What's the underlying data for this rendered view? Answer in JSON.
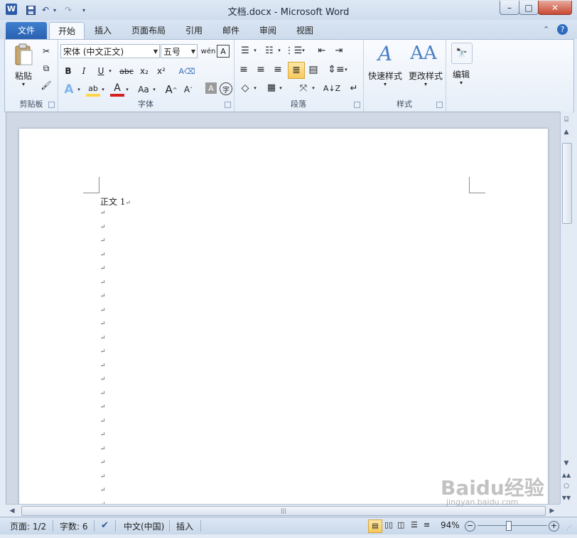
{
  "window": {
    "title": "文档.docx - Microsoft Word",
    "app_icon": "W",
    "controls": {
      "minimize": "–",
      "maximize": "□",
      "close": "✕"
    }
  },
  "quick_access": {
    "save_icon": "save-icon",
    "undo_icon": "undo-icon",
    "redo_icon": "redo-icon"
  },
  "tabs": [
    {
      "label": "文件"
    },
    {
      "label": "开始"
    },
    {
      "label": "插入"
    },
    {
      "label": "页面布局"
    },
    {
      "label": "引用"
    },
    {
      "label": "邮件"
    },
    {
      "label": "审阅"
    },
    {
      "label": "视图"
    }
  ],
  "ribbon": {
    "clipboard": {
      "label": "剪贴板",
      "paste": "粘贴"
    },
    "font": {
      "label": "字体",
      "font_name": "宋体 (中文正文)",
      "font_size": "五号",
      "bold": "B",
      "italic": "I",
      "underline": "U",
      "strike": "abc",
      "subscript": "x₂",
      "superscript": "x²",
      "case": "Aa",
      "grow": "A",
      "shrink": "A"
    },
    "paragraph": {
      "label": "段落"
    },
    "styles": {
      "label": "样式",
      "quick_styles": "快速样式",
      "change_styles": "更改样式"
    },
    "editing": {
      "label": "编辑"
    }
  },
  "document": {
    "first_line": "正文 1",
    "paragraph_mark": "↵",
    "empty_paragraphs": 22
  },
  "status": {
    "page": "页面: 1/2",
    "words": "字数: 6",
    "language": "中文(中国)",
    "mode": "插入",
    "zoom": "94%"
  },
  "watermark": {
    "brand": "Baidu经验",
    "url": "jingyan.baidu.com"
  },
  "colors": {
    "accent": "#2a61b0",
    "highlight": "#ffd54a",
    "font_color": "#d42020"
  }
}
